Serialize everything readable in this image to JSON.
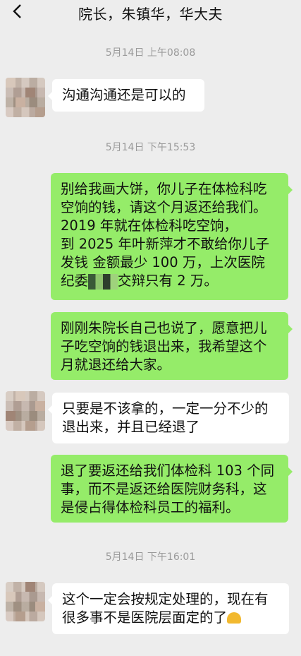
{
  "header": {
    "title": "院长，朱镇华，华大夫",
    "back_icon": "chevron-left-icon"
  },
  "timestamps": [
    "5月14日 上午08:08",
    "5月14日 下午15:53",
    "5月14日 下午16:01"
  ],
  "messages": [
    {
      "side": "left",
      "text": "沟通沟通还是可以的"
    },
    {
      "side": "right",
      "lines": [
        "别给我画大饼，你儿子在体检科吃",
        "空饷的钱，请这个月返还给我们。",
        "2019 年就在体检科吃空饷，",
        "到 2025 年叶新萍才不敢给你儿子",
        "发钱   金额最少 100 万，上次医院",
        "纪委",
        "交辩只有 2 万。"
      ]
    },
    {
      "side": "right",
      "lines": [
        "刚刚朱院长自己也说了，愿意把儿",
        "子吃空饷的钱退出来，我希望这个",
        "月就退还给大家。"
      ]
    },
    {
      "side": "left",
      "lines": [
        "只要是不该拿的，一定一分不少的",
        "退出来，并且已经退了"
      ]
    },
    {
      "side": "right",
      "lines": [
        "退了要返还给我们体检科 103 个同",
        "事，而不是返还给医院财务科，这",
        "是侵占得体检科员工的福利。"
      ]
    },
    {
      "side": "left",
      "lines": [
        "这个一定会按规定处理的，现在有",
        "很多事不是医院层面定的了"
      ]
    }
  ],
  "colors": {
    "background": "#ededed",
    "sent_bubble": "#95ec69",
    "received_bubble": "#ffffff",
    "timestamp_text": "#9a9a9a"
  }
}
